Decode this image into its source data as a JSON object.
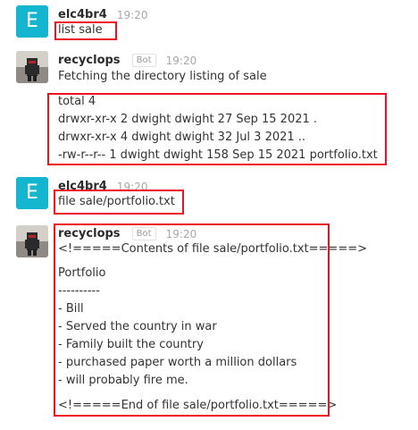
{
  "messages": [
    {
      "avatar_letter": "E",
      "username": "elc4br4",
      "time": "19:20",
      "text": "list sale"
    },
    {
      "username": "recyclops",
      "badge": "Bot",
      "time": "19:20",
      "text": "Fetching the directory listing of sale",
      "code": [
        "total 4",
        "drwxr-xr-x 2 dwight dwight 27 Sep 15 2021 .",
        "drwxr-xr-x 4 dwight dwight 32 Jul 3 2021 ..",
        "-rw-r--r-- 1 dwight dwight 158 Sep 15 2021 portfolio.txt"
      ]
    },
    {
      "avatar_letter": "E",
      "username": "elc4br4",
      "time": "19:20",
      "text": "file sale/portfolio.txt"
    },
    {
      "username": "recyclops",
      "badge": "Bot",
      "time": "19:20",
      "file_lines": [
        "<!=====Contents of file sale/portfolio.txt=====>",
        "",
        "Portfolio",
        "----------",
        "- Bill",
        "- Served the country in war",
        "- Family built the country",
        "- purchased paper worth a million dollars",
        "- will probably fire me.",
        "",
        "<!=====End of file sale/portfolio.txt=====>"
      ]
    }
  ],
  "colors": {
    "avatar_bg": "#14b6cf",
    "highlight_border": "#ee1122"
  }
}
